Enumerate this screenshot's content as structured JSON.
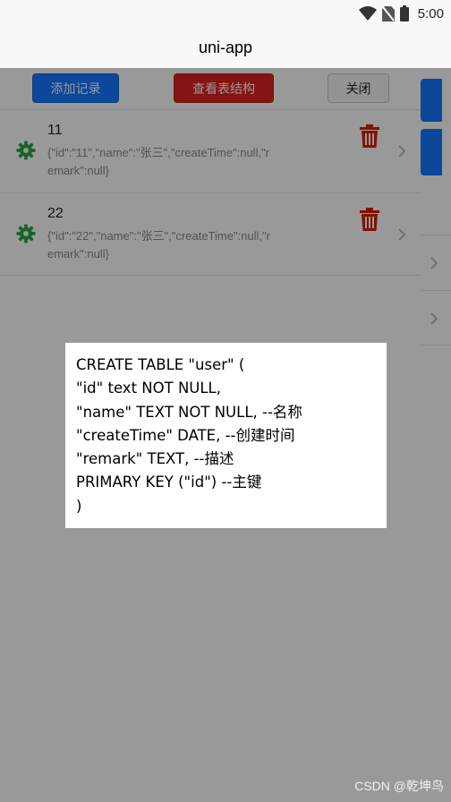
{
  "status_bar": {
    "time": "5:00",
    "icons": [
      "wifi-icon",
      "no-sim-icon",
      "battery-icon"
    ]
  },
  "navbar": {
    "title": "uni-app"
  },
  "toolbar": {
    "add_label": "添加记录",
    "view_label": "查看表结构",
    "close_label": "关闭"
  },
  "records": [
    {
      "title": "11",
      "note": "{\"id\":\"11\",\"name\":\"张三\",\"createTime\":null,\"remark\":null}"
    },
    {
      "title": "22",
      "note": "{\"id\":\"22\",\"name\":\"张三\",\"createTime\":null,\"remark\":null}"
    }
  ],
  "schema_modal": {
    "lines": [
      "CREATE TABLE \"user\" (",
      "\"id\" text NOT NULL,",
      "\"name\" TEXT NOT NULL, --名称",
      "\"createTime\" DATE, --创建时间",
      "\"remark\" TEXT, --描述",
      "PRIMARY KEY (\"id\") --主键",
      ")"
    ]
  },
  "watermark": "CSDN @乾坤鸟",
  "colors": {
    "primary_blue": "#1677ff",
    "danger_red": "#e02020",
    "icon_red": "#d81e06",
    "gear_green": "#2ba245"
  }
}
